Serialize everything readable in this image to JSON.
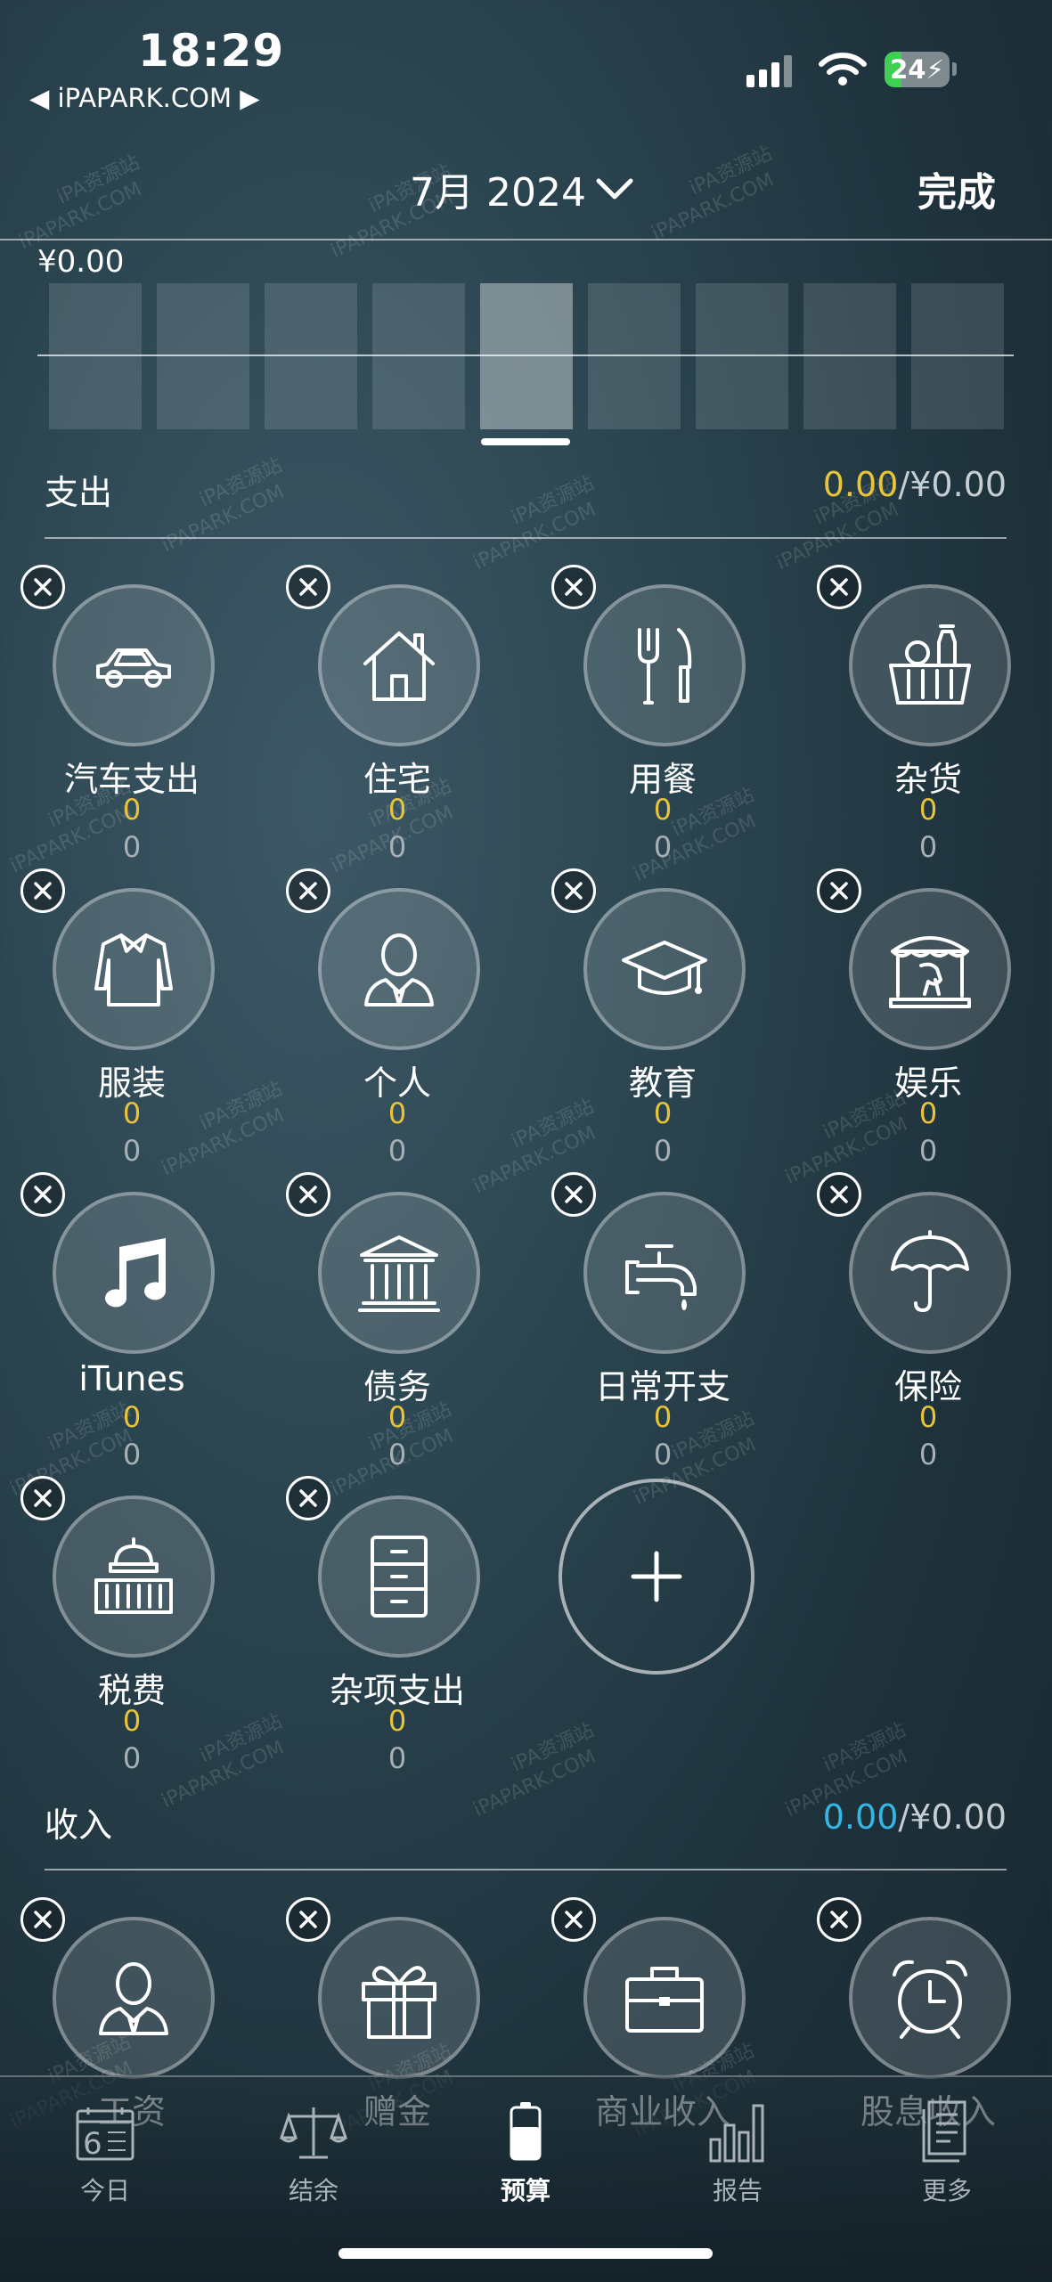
{
  "status_bar": {
    "time": "18:29",
    "carrier": "◀ iPAPARK.COM ▶",
    "battery": "24"
  },
  "header": {
    "month": "7月 2024",
    "done": "完成"
  },
  "chart": {
    "amount": "¥0.00",
    "bar_count": 9,
    "selected_index": 4
  },
  "expense": {
    "title": "支出",
    "spent": "0.00",
    "budget": "/¥0.00",
    "categories": [
      {
        "name": "汽车支出",
        "icon": "car-icon",
        "spent": "0",
        "budget": "0"
      },
      {
        "name": "住宅",
        "icon": "house-icon",
        "spent": "0",
        "budget": "0"
      },
      {
        "name": "用餐",
        "icon": "fork-knife-icon",
        "spent": "0",
        "budget": "0"
      },
      {
        "name": "杂货",
        "icon": "grocery-basket-icon",
        "spent": "0",
        "budget": "0"
      },
      {
        "name": "服装",
        "icon": "sweater-icon",
        "spent": "0",
        "budget": "0"
      },
      {
        "name": "个人",
        "icon": "person-icon",
        "spent": "0",
        "budget": "0"
      },
      {
        "name": "教育",
        "icon": "graduation-cap-icon",
        "spent": "0",
        "budget": "0"
      },
      {
        "name": "娱乐",
        "icon": "carousel-icon",
        "spent": "0",
        "budget": "0"
      },
      {
        "name": "iTunes",
        "icon": "music-note-icon",
        "spent": "0",
        "budget": "0"
      },
      {
        "name": "债务",
        "icon": "bank-icon",
        "spent": "0",
        "budget": "0"
      },
      {
        "name": "日常开支",
        "icon": "faucet-icon",
        "spent": "0",
        "budget": "0"
      },
      {
        "name": "保险",
        "icon": "umbrella-icon",
        "spent": "0",
        "budget": "0"
      },
      {
        "name": "税费",
        "icon": "capitol-icon",
        "spent": "0",
        "budget": "0"
      },
      {
        "name": "杂项支出",
        "icon": "cabinet-icon",
        "spent": "0",
        "budget": "0"
      }
    ]
  },
  "income": {
    "title": "收入",
    "spent": "0.00",
    "budget": "/¥0.00",
    "categories": [
      {
        "name": "工资",
        "icon": "person-icon"
      },
      {
        "name": "赠金",
        "icon": "gift-icon"
      },
      {
        "name": "商业收入",
        "icon": "briefcase-icon"
      },
      {
        "name": "股息收入",
        "icon": "alarm-clock-icon"
      }
    ]
  },
  "tabs": [
    {
      "label": "今日",
      "icon": "calendar-icon"
    },
    {
      "label": "结余",
      "icon": "scale-icon"
    },
    {
      "label": "预算",
      "icon": "battery-icon"
    },
    {
      "label": "报告",
      "icon": "bar-chart-icon"
    },
    {
      "label": "更多",
      "icon": "document-icon"
    }
  ],
  "calendar_day": "6",
  "watermark": [
    "iPA资源站",
    "iPAPARK.COM"
  ],
  "colors": {
    "spent_accent": "#e8c43a",
    "income_accent": "#34b7e4"
  }
}
